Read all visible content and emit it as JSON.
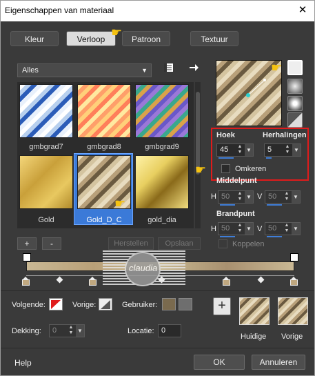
{
  "window": {
    "title": "Eigenschappen van materiaal",
    "close_glyph": "✕"
  },
  "tabs": [
    {
      "label": "Kleur",
      "active": false
    },
    {
      "label": "Verloop",
      "active": true
    },
    {
      "label": "Patroon",
      "active": false
    },
    {
      "label": "Textuur",
      "active": false
    }
  ],
  "category": {
    "selected": "Alles"
  },
  "gradients": [
    {
      "name": "gmbgrad7"
    },
    {
      "name": "gmbgrad8"
    },
    {
      "name": "gmbgrad9"
    },
    {
      "name": "Gold"
    },
    {
      "name": "Gold_D_C",
      "selected": true
    },
    {
      "name": "gold_dia"
    }
  ],
  "list_buttons": {
    "add": "+",
    "remove": "-",
    "restore": "Herstellen",
    "save": "Opslaan"
  },
  "settings": {
    "angle_label": "Hoek",
    "angle_value": "45",
    "repeats_label": "Herhalingen",
    "repeats_value": "5",
    "invert_label": "Omkeren",
    "center_label": "Middelpunt",
    "center_h_label": "H",
    "center_h": "50",
    "center_v_label": "V",
    "center_v": "50",
    "focus_label": "Brandpunt",
    "focus_h_label": "H",
    "focus_h": "50",
    "focus_v_label": "V",
    "focus_v": "50",
    "link_label": "Koppelen"
  },
  "stops": {
    "next_label": "Volgende:",
    "prev_label": "Vorige:",
    "user_label": "Gebruiker:",
    "opacity_label": "Dekking:",
    "opacity_value": "0",
    "location_label": "Locatie:",
    "location_value": "0",
    "user_color": "#7a6a4e"
  },
  "previews": {
    "current_label": "Huidige",
    "previous_label": "Vorige"
  },
  "footer": {
    "help": "Help",
    "ok": "OK",
    "cancel": "Annuleren"
  },
  "watermark": {
    "text": "claudia"
  },
  "colors": {
    "selected_highlight": "#3b7ad8",
    "annotation_red": "#e01b1b",
    "pointer_hand": "#f5c211"
  }
}
